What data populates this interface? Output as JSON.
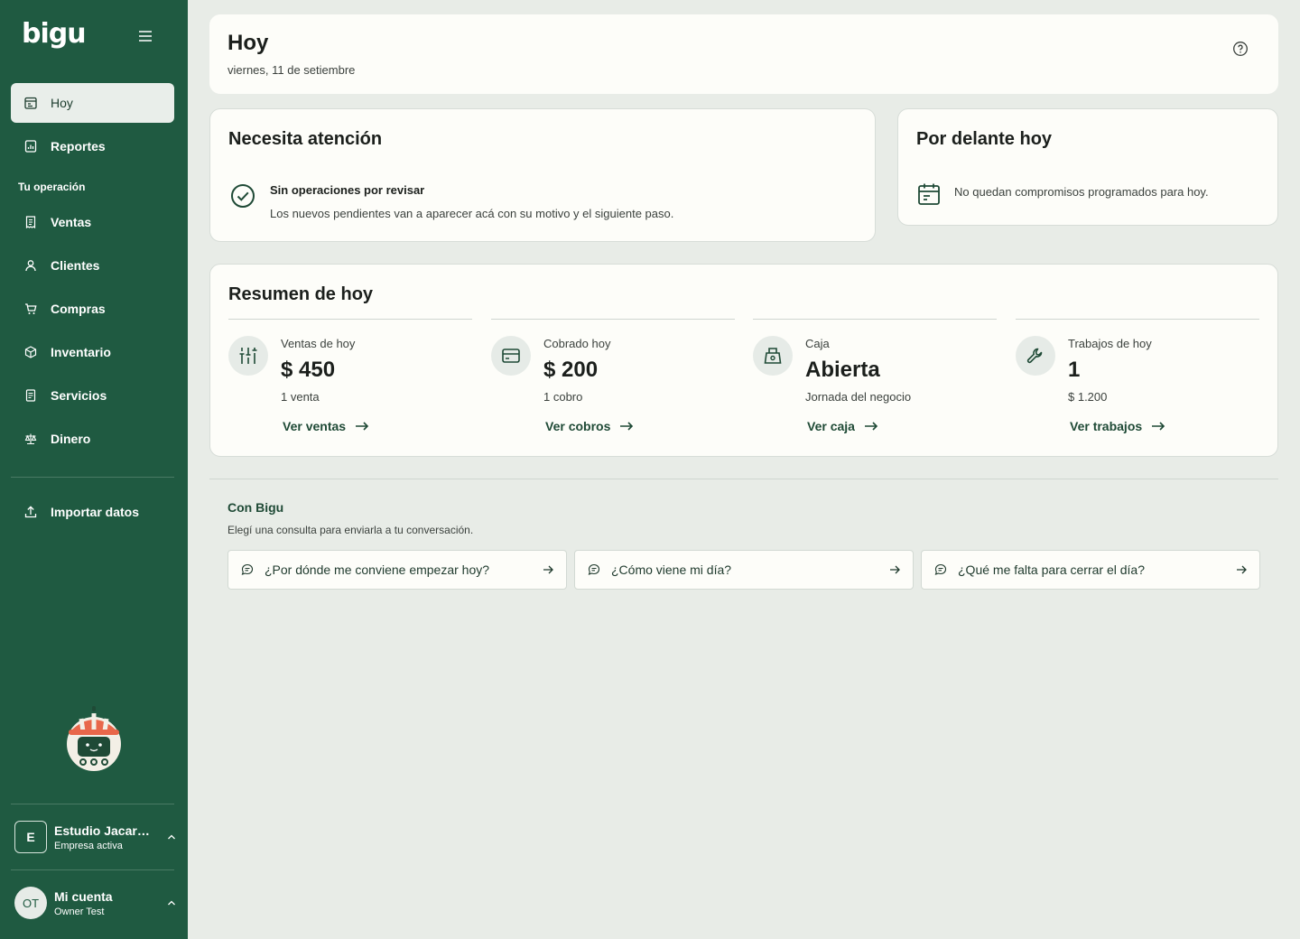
{
  "colors": {
    "sidebar_bg": "#1f5a41",
    "page_bg": "#e8ece7",
    "card_bg": "#fdfdf9",
    "accent": "#1f4a36"
  },
  "sidebar": {
    "logo": "bigu",
    "nav_top": [
      {
        "label": "Hoy",
        "icon": "calendar-day-icon",
        "active": true
      },
      {
        "label": "Reportes",
        "icon": "report-icon"
      }
    ],
    "section_label": "Tu operación",
    "nav_ops": [
      {
        "label": "Ventas",
        "icon": "receipt-icon"
      },
      {
        "label": "Clientes",
        "icon": "user-icon"
      },
      {
        "label": "Compras",
        "icon": "cart-icon"
      },
      {
        "label": "Inventario",
        "icon": "box-icon"
      },
      {
        "label": "Servicios",
        "icon": "document-icon"
      },
      {
        "label": "Dinero",
        "icon": "scale-icon"
      }
    ],
    "import_label": "Importar datos",
    "company": {
      "initial": "E",
      "name": "Estudio Jacara...",
      "status": "Empresa activa"
    },
    "account": {
      "initials": "OT",
      "title": "Mi cuenta",
      "name": "Owner Test"
    }
  },
  "header": {
    "title": "Hoy",
    "date": "viernes, 11 de setiembre"
  },
  "attention": {
    "title": "Necesita atención",
    "strong": "Sin operaciones por revisar",
    "text": "Los nuevos pendientes van a aparecer acá con su motivo y el siguiente paso."
  },
  "ahead": {
    "title": "Por delante hoy",
    "text": "No quedan compromisos programados para hoy."
  },
  "summary": {
    "title": "Resumen de hoy",
    "metrics": [
      {
        "label": "Ventas de hoy",
        "value": "$ 450",
        "sub": "1 venta",
        "link": "Ver ventas",
        "icon": "sliders-icon"
      },
      {
        "label": "Cobrado hoy",
        "value": "$ 200",
        "sub": "1 cobro",
        "link": "Ver cobros",
        "icon": "card-icon"
      },
      {
        "label": "Caja",
        "value": "Abierta",
        "sub": "Jornada del negocio",
        "link": "Ver caja",
        "icon": "cash-register-icon"
      },
      {
        "label": "Trabajos de hoy",
        "value": "1",
        "sub": "$ 1.200",
        "link": "Ver trabajos",
        "icon": "wrench-icon"
      }
    ]
  },
  "con_bigu": {
    "title": "Con Bigu",
    "subtitle": "Elegí una consulta para enviarla a tu conversación.",
    "prompts": [
      "¿Por dónde me conviene empezar hoy?",
      "¿Cómo viene mi día?",
      "¿Qué me falta para cerrar el día?"
    ]
  }
}
